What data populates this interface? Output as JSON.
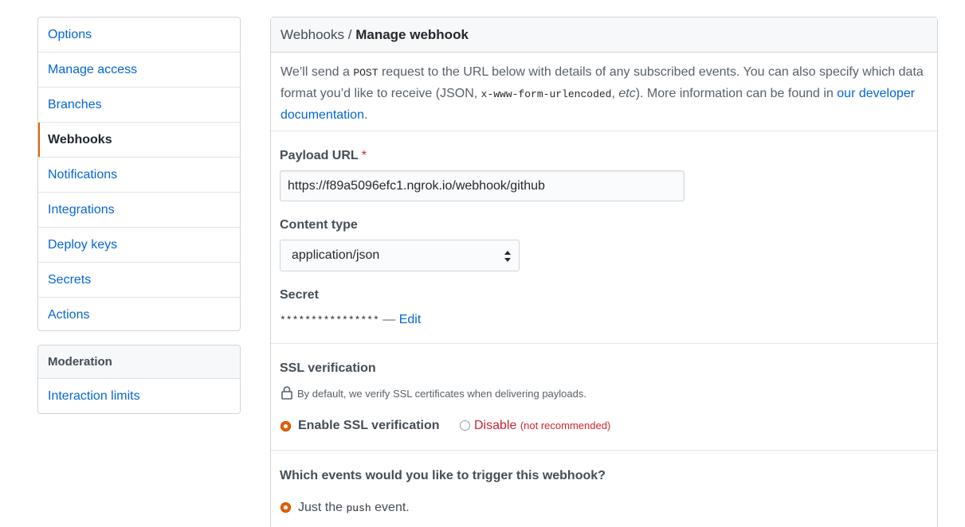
{
  "sidebar": {
    "items": [
      {
        "label": "Options"
      },
      {
        "label": "Manage access"
      },
      {
        "label": "Branches"
      },
      {
        "label": "Webhooks"
      },
      {
        "label": "Notifications"
      },
      {
        "label": "Integrations"
      },
      {
        "label": "Deploy keys"
      },
      {
        "label": "Secrets"
      },
      {
        "label": "Actions"
      }
    ],
    "selected": "Webhooks",
    "moderation": {
      "heading": "Moderation",
      "items": [
        {
          "label": "Interaction limits"
        }
      ]
    }
  },
  "header": {
    "breadcrumb_parent": "Webhooks",
    "separator": "/",
    "title": "Manage webhook"
  },
  "intro": {
    "text_1": "We’ll send a ",
    "code_1": "POST",
    "text_2": " request to the URL below with details of any subscribed events. You can also specify which data format you’d like to receive (JSON, ",
    "code_2": "x-www-form-urlencoded",
    "text_3": ", ",
    "em": "etc",
    "text_4": "). More information can be found in ",
    "link": "our developer documentation",
    "text_5": "."
  },
  "form": {
    "payload_url": {
      "label": "Payload URL",
      "required_mark": "*",
      "value": "https://f89a5096efc1.ngrok.io/webhook/github"
    },
    "content_type": {
      "label": "Content type",
      "value": "application/json"
    },
    "secret": {
      "label": "Secret",
      "masked": "****************",
      "dash": " — ",
      "edit": "Edit"
    }
  },
  "ssl": {
    "heading": "SSL verification",
    "note": "By default, we verify SSL certificates when delivering payloads.",
    "enable_label": "Enable SSL verification",
    "disable_label": "Disable",
    "disable_note": "(not recommended)",
    "selected": "enable"
  },
  "events": {
    "heading": "Which events would you like to trigger this webhook?",
    "option_1_pre": "Just the ",
    "option_1_code": "push",
    "option_1_post": " event.",
    "selected": "push"
  },
  "colors": {
    "link": "#0366d6",
    "accent": "#e36209",
    "danger": "#cb2431"
  }
}
